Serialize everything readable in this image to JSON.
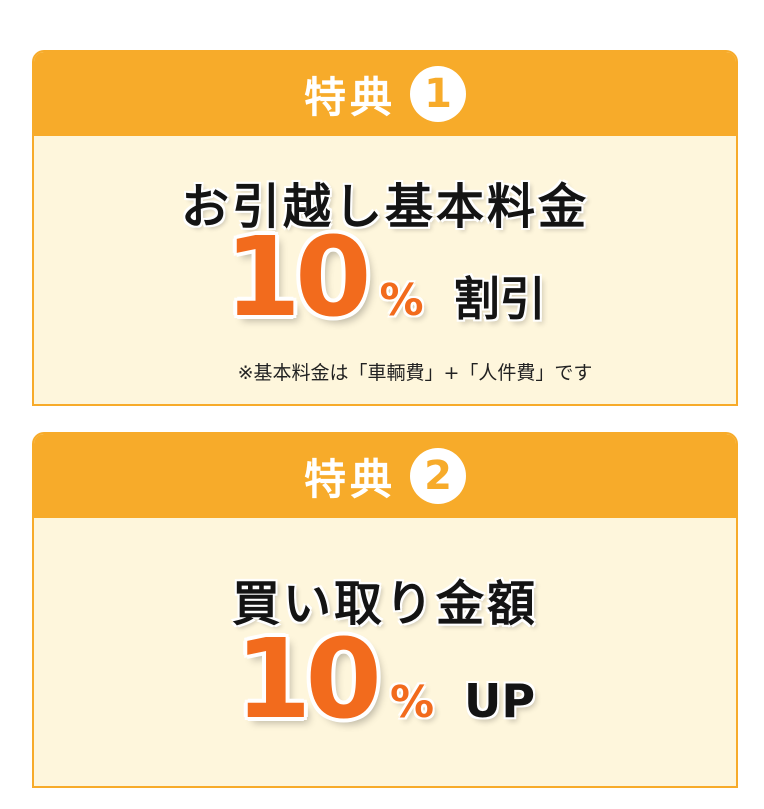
{
  "benefits": [
    {
      "header_label": "特典",
      "number_badge": "1",
      "title": "お引越し基本料金",
      "big_number": "10",
      "percent": "%",
      "suffix": "割引",
      "note": "※基本料金は「車輌費」+「人件費」です"
    },
    {
      "header_label": "特典",
      "number_badge": "2",
      "title": "買い取り金額",
      "big_number": "10",
      "percent": "%",
      "suffix": "UP"
    }
  ],
  "colors": {
    "header_bg": "#f7ab2a",
    "card_bg": "#fef6dc",
    "accent_orange": "#f26b1d",
    "title_text": "#141414"
  }
}
